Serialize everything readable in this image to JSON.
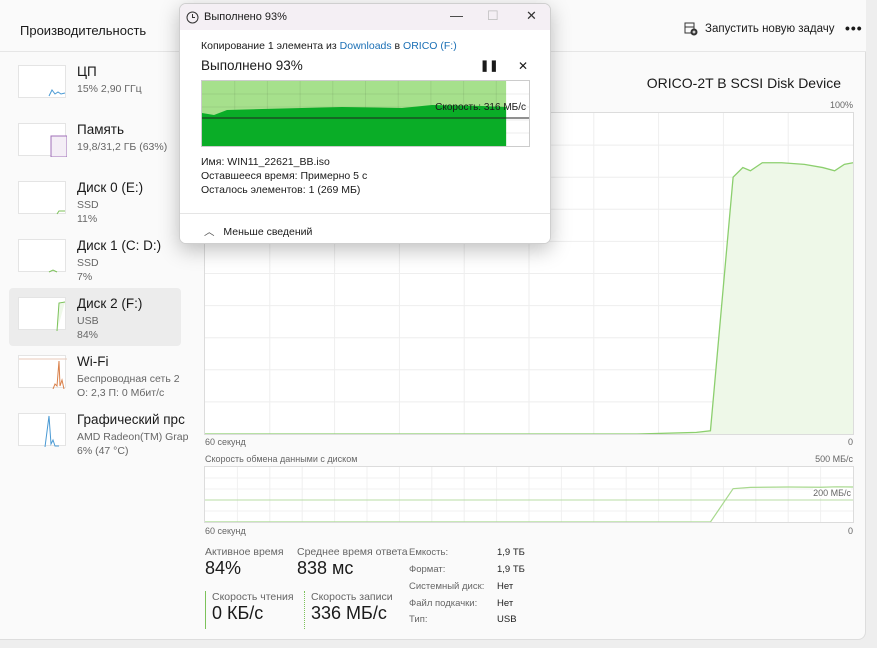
{
  "header": {
    "title": "Производительность",
    "new_task": "Запустить новую задачу",
    "more": "•••"
  },
  "sidebar": {
    "items": [
      {
        "name": "ЦП",
        "sub1": "15% 2,90 ГГц",
        "sub2": ""
      },
      {
        "name": "Память",
        "sub1": "19,8/31,2 ГБ (63%)",
        "sub2": ""
      },
      {
        "name": "Диск 0 (E:)",
        "sub1": "SSD",
        "sub2": "11%"
      },
      {
        "name": "Диск 1 (C: D:)",
        "sub1": "SSD",
        "sub2": "7%"
      },
      {
        "name": "Диск 2 (F:)",
        "sub1": "USB",
        "sub2": "84%"
      },
      {
        "name": "Wi-Fi",
        "sub1": "Беспроводная сеть 2",
        "sub2": "О: 2,3 П: 0 Мбит/с"
      },
      {
        "name": "Графический прс",
        "sub1": "AMD Radeon(TM) Graphics",
        "sub2": "6% (47 °C)"
      }
    ]
  },
  "main": {
    "device": "ORICO-2T B SCSI Disk Device",
    "active_graph": {
      "max_label": "100%",
      "time_label": "60 секунд",
      "min_label": "0",
      "color": "#8ccf6e",
      "points": [
        [
          60,
          0
        ],
        [
          20,
          0
        ],
        [
          14.5,
          0.5
        ],
        [
          13.2,
          1
        ],
        [
          11.1,
          80
        ],
        [
          10.2,
          83
        ],
        [
          9.5,
          82
        ],
        [
          8.4,
          84.5
        ],
        [
          6.6,
          84.5
        ],
        [
          4.5,
          84
        ],
        [
          2.8,
          83
        ],
        [
          1.7,
          82
        ],
        [
          0.8,
          84
        ],
        [
          0,
          84.5
        ]
      ]
    },
    "transfer_graph": {
      "title": "Скорость обмена данными с диском",
      "max_label": "500 МБ/с",
      "ref_label": "200 МБ/с",
      "ref_value": 200,
      "max": 500,
      "time_label": "60 секунд",
      "min_label": "0",
      "points": [
        [
          60,
          0
        ],
        [
          13.2,
          0
        ],
        [
          11.1,
          303
        ],
        [
          9.5,
          315
        ],
        [
          6,
          318
        ],
        [
          3,
          316
        ],
        [
          1.5,
          320
        ],
        [
          0,
          318
        ]
      ]
    },
    "stats": {
      "active_label": "Активное время",
      "active_value": "84%",
      "resp_label": "Среднее время ответа",
      "resp_value": "838 мс",
      "read_label": "Скорость чтения",
      "read_value": "0 КБ/с",
      "write_label": "Скорость записи",
      "write_value": "336 МБ/с"
    },
    "props": [
      [
        "Емкость:",
        "1,9 ТБ"
      ],
      [
        "Формат:",
        "1,9 ТБ"
      ],
      [
        "Системный диск:",
        "Нет"
      ],
      [
        "Файл подкачки:",
        "Нет"
      ],
      [
        "Тип:",
        "USB"
      ]
    ]
  },
  "dialog": {
    "title": "Выполнено 93%",
    "copy_prefix": "Копирование 1 элемента из",
    "source": "Downloads",
    "in": "в",
    "dest": "ORICO (F:)",
    "heading": "Выполнено 93%",
    "progress_percent": 93,
    "speed_label": "Скорость: 316 МБ/с",
    "name": "Имя: WIN11_22621_BB.iso",
    "time_left": "Оставшееся время: Примерно 5 с",
    "items_left": "Осталось элементов: 1 (269 МБ)",
    "less": "Меньше сведений"
  }
}
